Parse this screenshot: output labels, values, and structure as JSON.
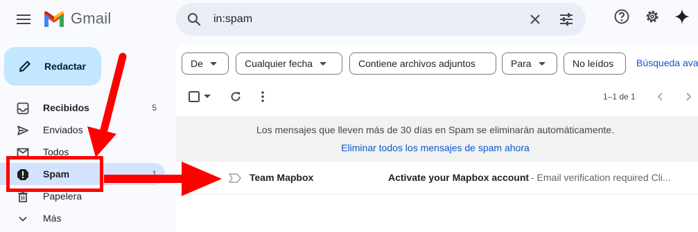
{
  "app": {
    "name": "Gmail"
  },
  "search": {
    "value": "in:spam"
  },
  "compose": {
    "label": "Redactar"
  },
  "sidebar": {
    "items": [
      {
        "label": "Recibidos",
        "count": "5"
      },
      {
        "label": "Enviados",
        "count": ""
      },
      {
        "label": "Todos",
        "count": ""
      },
      {
        "label": "Spam",
        "count": "1"
      },
      {
        "label": "Papelera",
        "count": ""
      },
      {
        "label": "Más",
        "count": ""
      }
    ]
  },
  "filters": {
    "chips": [
      "De",
      "Cualquier fecha",
      "Contiene archivos adjuntos",
      "Para",
      "No leídos"
    ],
    "advanced_label": "Búsqueda ava"
  },
  "toolbar": {
    "pager": "1–1 de 1"
  },
  "notice": {
    "message": "Los mensajes que lleven más de 30 días en Spam se eliminarán automáticamente.",
    "link": "Eliminar todos los mensajes de spam ahora"
  },
  "emails": [
    {
      "sender": "Team Mapbox",
      "subject": "Activate your Mapbox account",
      "snippet": " - Email verification required Cli..."
    }
  ],
  "icons": {
    "menu": "menu-icon",
    "search": "search-icon",
    "clear": "close-icon",
    "tune": "tune-icon",
    "help": "help-icon",
    "settings": "gear-icon",
    "gemini": "sparkle-icon"
  },
  "colors": {
    "accent": "#0b57d0",
    "compose_bg": "#c2e7ff",
    "active_nav": "#d3e3fd",
    "annotation": "#ff0000"
  }
}
